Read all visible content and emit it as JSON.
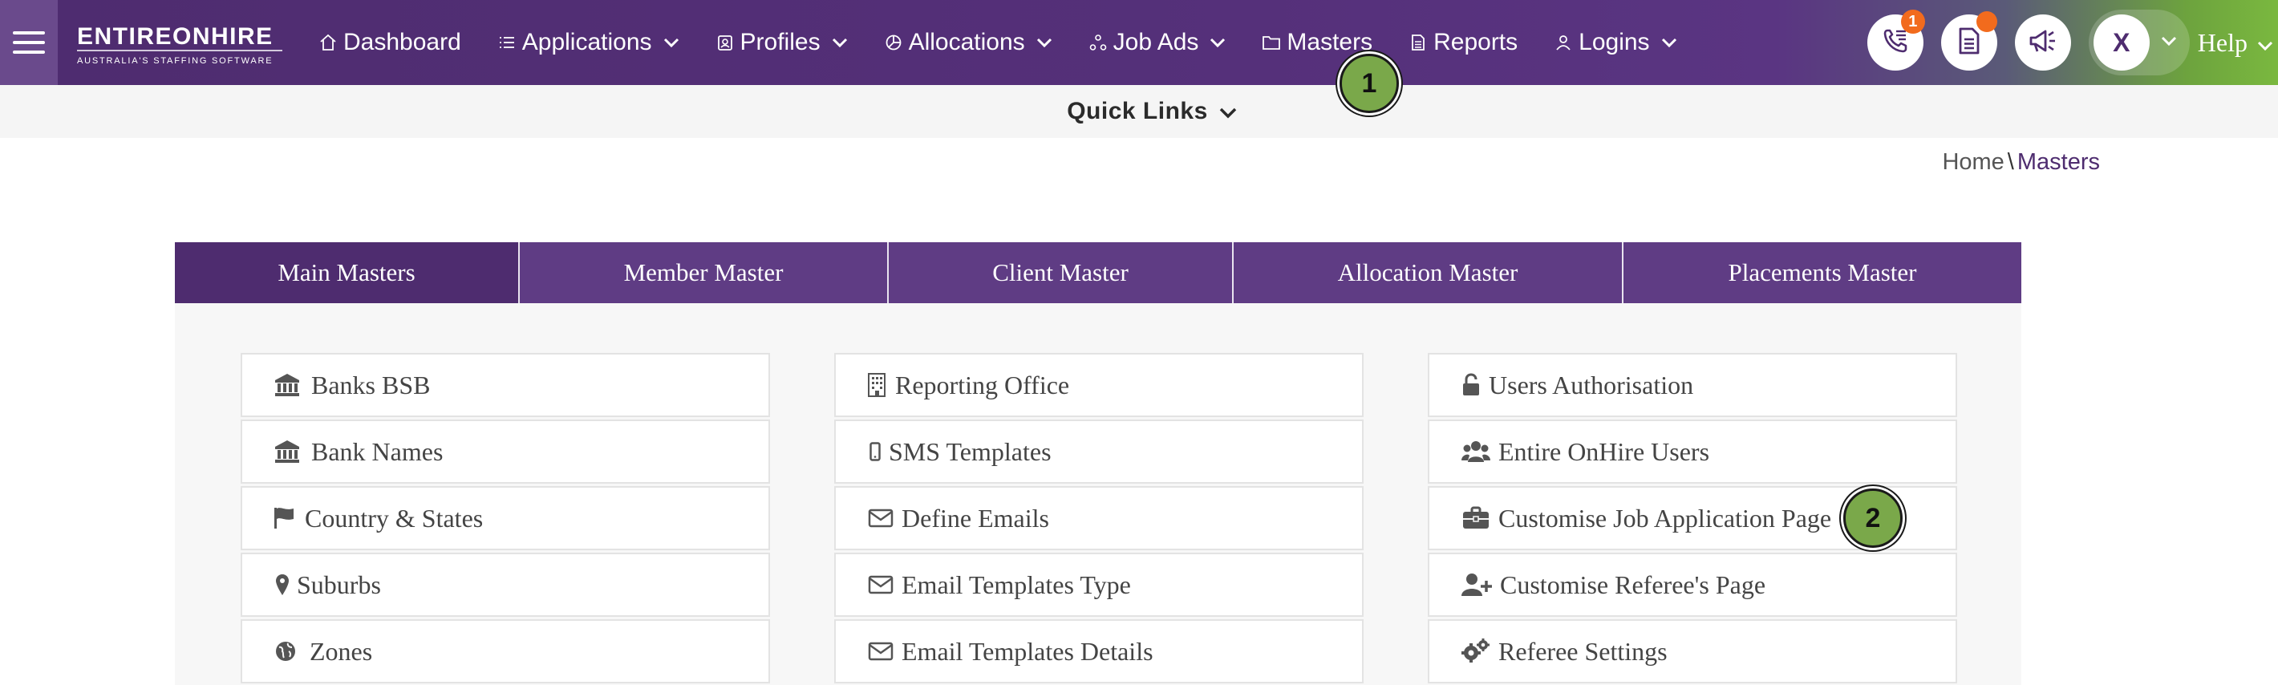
{
  "nav": {
    "brand": {
      "name": "ENTIREONHIRE",
      "tagline": "AUSTRALIA'S STAFFING SOFTWARE"
    },
    "items": [
      {
        "label": "Dashboard",
        "icon": "home-icon",
        "has_dropdown": false
      },
      {
        "label": "Applications",
        "icon": "list-icon",
        "has_dropdown": true
      },
      {
        "label": "Profiles",
        "icon": "id-badge-icon",
        "has_dropdown": true
      },
      {
        "label": "Allocations",
        "icon": "pie-chart-icon",
        "has_dropdown": true
      },
      {
        "label": "Job Ads",
        "icon": "network-icon",
        "has_dropdown": true
      },
      {
        "label": "Masters",
        "icon": "folder-icon",
        "has_dropdown": false
      },
      {
        "label": "Reports",
        "icon": "document-icon",
        "has_dropdown": false
      },
      {
        "label": "Logins",
        "icon": "user-icon",
        "has_dropdown": true
      }
    ],
    "tools": {
      "calls_badge": "1",
      "avatar_initial": "X",
      "help_label": "Help"
    }
  },
  "quick_links": {
    "label": "Quick Links"
  },
  "breadcrumb": {
    "home": "Home",
    "separator": "\\",
    "current": "Masters"
  },
  "tabs": [
    {
      "label": "Main Masters",
      "active": true
    },
    {
      "label": "Member Master",
      "active": false
    },
    {
      "label": "Client Master",
      "active": false
    },
    {
      "label": "Allocation Master",
      "active": false
    },
    {
      "label": "Placements Master",
      "active": false
    }
  ],
  "columns": [
    [
      {
        "label": "Banks BSB",
        "icon": "bank-icon"
      },
      {
        "label": "Bank Names",
        "icon": "bank-icon"
      },
      {
        "label": "Country & States",
        "icon": "flag-icon"
      },
      {
        "label": "Suburbs",
        "icon": "map-marker-icon"
      },
      {
        "label": "Zones",
        "icon": "globe-icon"
      }
    ],
    [
      {
        "label": "Reporting Office",
        "icon": "building-icon"
      },
      {
        "label": "SMS Templates",
        "icon": "mobile-icon"
      },
      {
        "label": "Define Emails",
        "icon": "envelope-icon"
      },
      {
        "label": "Email Templates Type",
        "icon": "envelope-icon"
      },
      {
        "label": "Email Templates Details",
        "icon": "envelope-icon"
      }
    ],
    [
      {
        "label": "Users Authorisation",
        "icon": "unlock-icon"
      },
      {
        "label": "Entire OnHire Users",
        "icon": "users-icon"
      },
      {
        "label": "Customise Job Application Page",
        "icon": "briefcase-icon"
      },
      {
        "label": "Customise Referee's Page",
        "icon": "user-plus-icon"
      },
      {
        "label": "Referee Settings",
        "icon": "cogs-icon"
      }
    ]
  ],
  "markers": [
    {
      "number": "1"
    },
    {
      "number": "2"
    }
  ],
  "colors": {
    "brand_purple": "#4e2c6f",
    "tab_purple": "#5f3c84",
    "accent_green": "#7ab83f",
    "badge_orange": "#f26b1d",
    "marker_green": "#7aa84a"
  }
}
